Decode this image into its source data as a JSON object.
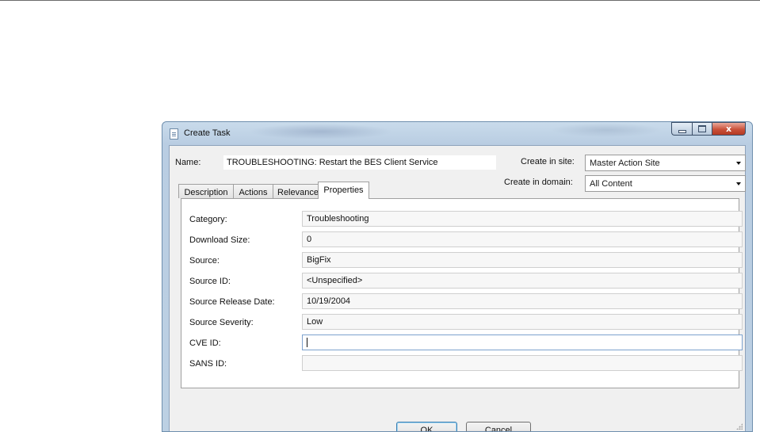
{
  "window": {
    "title": "Create Task",
    "caption_buttons": {
      "minimize": "–",
      "maximize": "□",
      "close": "x"
    }
  },
  "form": {
    "name_label": "Name:",
    "name_value": "TROUBLESHOOTING: Restart the BES Client Service",
    "site_label": "Create in site:",
    "site_value": "Master Action Site",
    "domain_label": "Create in domain:",
    "domain_value": "All Content"
  },
  "tabs": [
    {
      "label": "Description",
      "active": false
    },
    {
      "label": "Actions",
      "active": false
    },
    {
      "label": "Relevance",
      "active": false
    },
    {
      "label": "Properties",
      "active": true
    }
  ],
  "properties": [
    {
      "label": "Category:",
      "value": "Troubleshooting"
    },
    {
      "label": "Download Size:",
      "value": "0"
    },
    {
      "label": "Source:",
      "value": "BigFix"
    },
    {
      "label": "Source ID:",
      "value": "<Unspecified>"
    },
    {
      "label": "Source Release Date:",
      "value": "10/19/2004"
    },
    {
      "label": "Source Severity:",
      "value": "Low"
    },
    {
      "label": "CVE ID:",
      "value": ""
    },
    {
      "label": "SANS ID:",
      "value": ""
    }
  ],
  "buttons": {
    "ok": "OK",
    "cancel": "Cancel"
  },
  "colors": {
    "window_frame": "#bcd0e3",
    "client_bg": "#f0f0f0",
    "close_button": "#c9513a",
    "focus_border": "#7da2ce"
  }
}
